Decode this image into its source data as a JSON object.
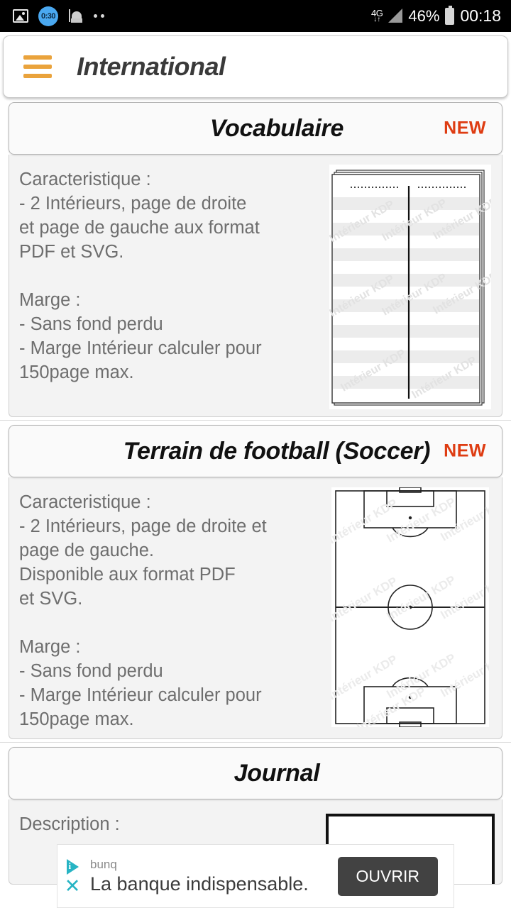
{
  "status_bar": {
    "icons": [
      "gallery-icon",
      "timer-icon",
      "mosque-icon",
      "dots-icon"
    ],
    "timer_label": "0:30",
    "network": "4G",
    "network_arrows": "↓↑",
    "battery_percent": "46%",
    "clock": "00:18"
  },
  "appbar": {
    "menu_icon": "hamburger-menu-icon",
    "title": "International",
    "menu_color": "#eaa33c"
  },
  "colors": {
    "accent_orange": "#eaa33c",
    "badge_red": "#de3c12",
    "card_body_bg": "#f3f3f3",
    "ad_cta_bg": "#424242",
    "ad_teal": "#27b4c4"
  },
  "cards": [
    {
      "title": "Vocabulaire",
      "badge": "NEW",
      "description": "Caracteristique :\n- 2 Intérieurs, page de droite\net page de gauche aux format\nPDF et SVG.\n\nMarge :\n- Sans fond perdu\n- Marge Intérieur calculer pour\n150page max.",
      "thumbnail": "vocabulary-page-preview",
      "thumbnail_watermark": "Intérieur KDP"
    },
    {
      "title": "Terrain de football (Soccer)",
      "badge": "NEW",
      "description": "Caracteristique :\n- 2 Intérieurs, page de droite et\npage de gauche.\nDisponible aux format PDF\net SVG.\n\nMarge :\n- Sans fond perdu\n- Marge Intérieur calculer pour\n150page max.",
      "thumbnail": "soccer-field-preview",
      "thumbnail_watermark": "Intérieur KDP"
    },
    {
      "title": "Journal",
      "badge": "",
      "description": "Description :",
      "thumbnail": "journal-page-preview",
      "thumbnail_watermark": ""
    }
  ],
  "ad": {
    "advertiser": "bunq",
    "headline": "La banque indispensable.",
    "cta_label": "OUVRIR",
    "adchoices_icon": "adchoices-icon",
    "close_icon": "close-icon"
  }
}
